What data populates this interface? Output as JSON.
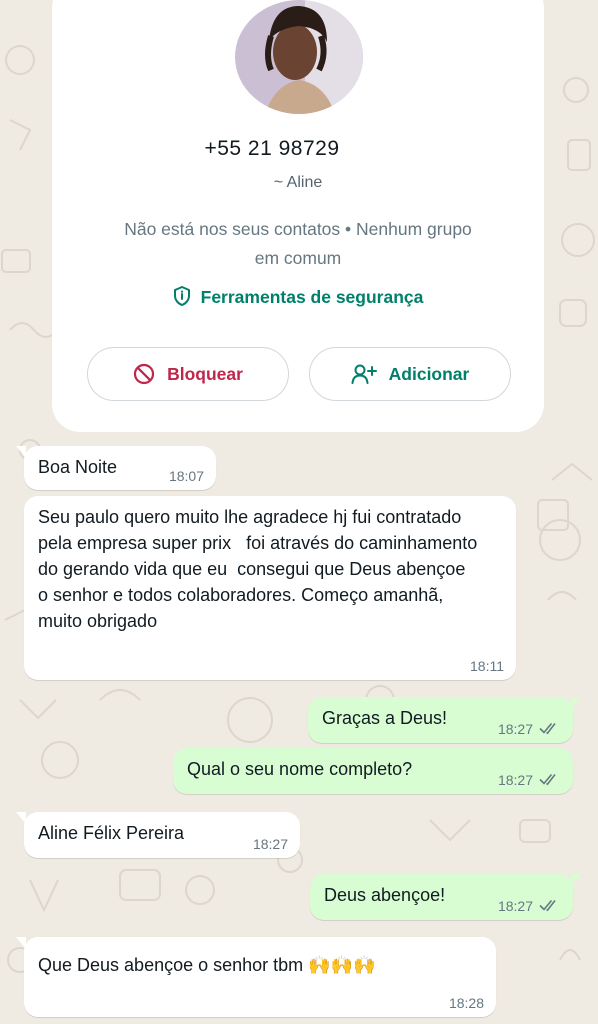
{
  "contact_card": {
    "phone": "+55 21 98729",
    "push_name": "~ Aline",
    "status_line": "Não está nos seus contatos • Nenhum grupo em comum",
    "security_label": "Ferramentas de segurança",
    "block_label": "Bloquear",
    "add_label": "Adicionar"
  },
  "messages": [
    {
      "direction": "incoming",
      "text": "Boa Noite",
      "time": "18:07"
    },
    {
      "direction": "incoming",
      "text": "Seu paulo quero muito lhe agradece hj fui contratado pela empresa super prix   foi através do caminhamento do gerando vida que eu  consegui que Deus abençoe o senhor e todos colaboradores. Começo amanhã, muito obrigado",
      "time": "18:11"
    },
    {
      "direction": "outgoing",
      "text": "Graças a Deus!",
      "time": "18:27",
      "status": "read"
    },
    {
      "direction": "outgoing",
      "text": "Qual o seu nome completo?",
      "time": "18:27",
      "status": "read"
    },
    {
      "direction": "incoming",
      "text": "Aline Félix Pereira",
      "time": "18:27"
    },
    {
      "direction": "outgoing",
      "text": "Deus abençoe!",
      "time": "18:27",
      "status": "read"
    },
    {
      "direction": "incoming",
      "text": "Que Deus abençoe o senhor tbm 🙌🙌🙌",
      "time": "18:28"
    }
  ],
  "colors": {
    "wallpaper": "#efeae2",
    "incoming_bubble": "#ffffff",
    "outgoing_bubble": "#d9fdd3",
    "accent_green": "#008069",
    "block_red": "#c0264b",
    "read_ticks": "#667781"
  }
}
